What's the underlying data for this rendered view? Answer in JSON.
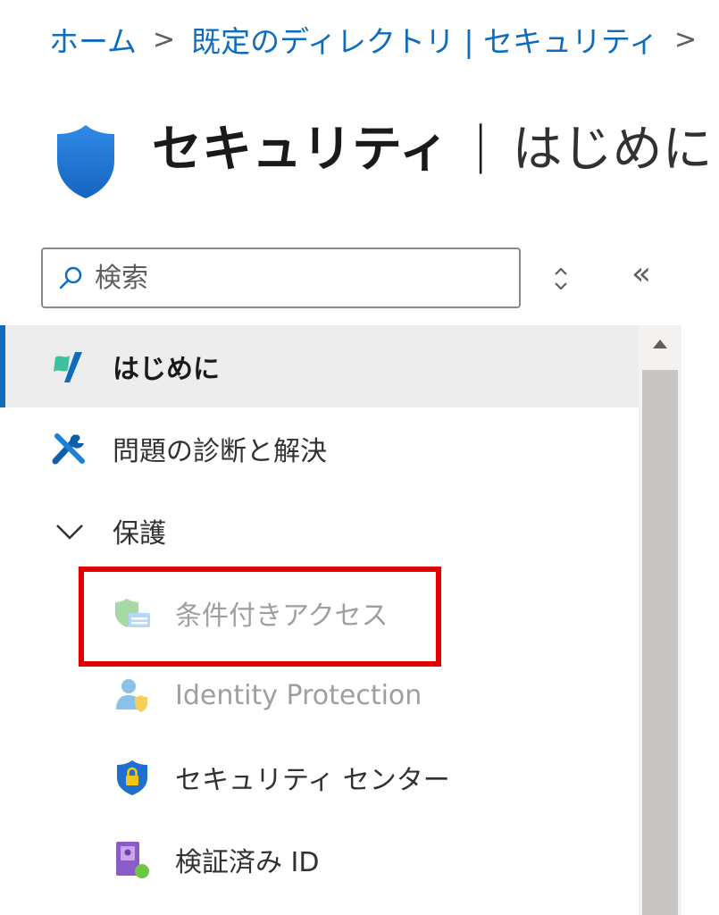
{
  "breadcrumb": {
    "home": "ホーム",
    "directory": "既定のディレクトリ | セキュリティ",
    "separator": ">"
  },
  "header": {
    "title": "セキュリティ",
    "divider": "|",
    "subtitle": "はじめに",
    "icon": "shield-icon"
  },
  "search": {
    "placeholder": "検索",
    "value": ""
  },
  "toolbar": {
    "collapse_label": "«"
  },
  "nav": {
    "items": [
      {
        "label": "はじめに",
        "icon": "quickstart-icon",
        "state": "active"
      },
      {
        "label": "問題の診断と解決",
        "icon": "tools-icon",
        "state": "normal"
      },
      {
        "label": "保護",
        "icon": "chevron-down-icon",
        "state": "expanded-group"
      },
      {
        "label": "条件付きアクセス",
        "icon": "conditional-access-icon",
        "state": "disabled"
      },
      {
        "label": "Identity Protection",
        "icon": "identity-protection-icon",
        "state": "disabled"
      },
      {
        "label": "セキュリティ センター",
        "icon": "security-center-shield-icon",
        "state": "normal"
      },
      {
        "label": "検証済み ID",
        "icon": "verified-id-icon",
        "state": "normal"
      }
    ]
  },
  "colors": {
    "link": "#0f6cbd",
    "active_bg": "#ededed",
    "active_indicator": "#0f6cbd",
    "disabled_text": "#a19f9d",
    "highlight_box": "#e00000"
  }
}
